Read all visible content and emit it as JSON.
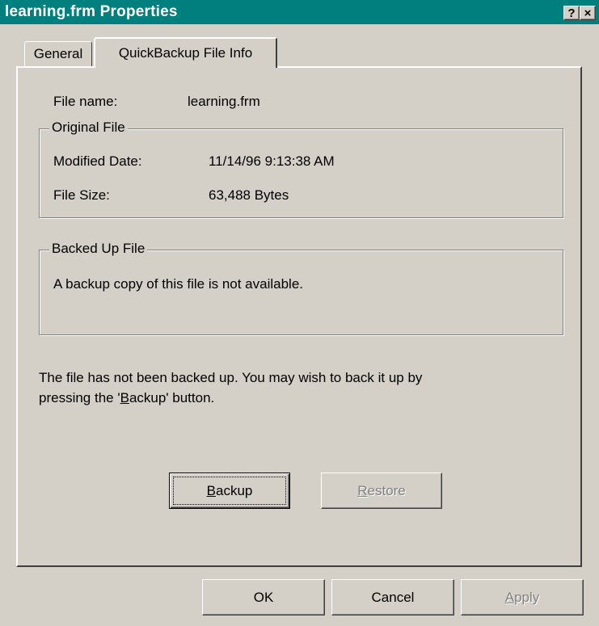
{
  "window": {
    "title": "learning.frm Properties",
    "help_label": "?",
    "close_label": "×"
  },
  "tabs": [
    {
      "label": "General"
    },
    {
      "label": "QuickBackup File Info"
    }
  ],
  "file_name": {
    "label": "File name:",
    "value": "learning.frm"
  },
  "original_file": {
    "legend": "Original File",
    "modified_label": "Modified Date:",
    "modified_value": "11/14/96 9:13:38 AM",
    "size_label": "File Size:",
    "size_value": "63,488 Bytes"
  },
  "backed_up_file": {
    "legend": "Backed Up File",
    "message": "A backup copy of this file is not available."
  },
  "notice": {
    "line1": "The file has not been backed up.  You may wish to back it up by",
    "line2_prefix": "pressing the '",
    "line2_mnemonic": "B",
    "line2_suffix": "ackup' button."
  },
  "action_buttons": {
    "backup_mnemonic": "B",
    "backup_rest": "ackup",
    "restore_mnemonic": "R",
    "restore_rest": "estore"
  },
  "dialog_buttons": {
    "ok": "OK",
    "cancel": "Cancel",
    "apply_mnemonic": "A",
    "apply_rest": "pply"
  },
  "colors": {
    "titlebar": "#007f7f",
    "face": "#d4d0c8",
    "disabled_text": "#808080"
  }
}
